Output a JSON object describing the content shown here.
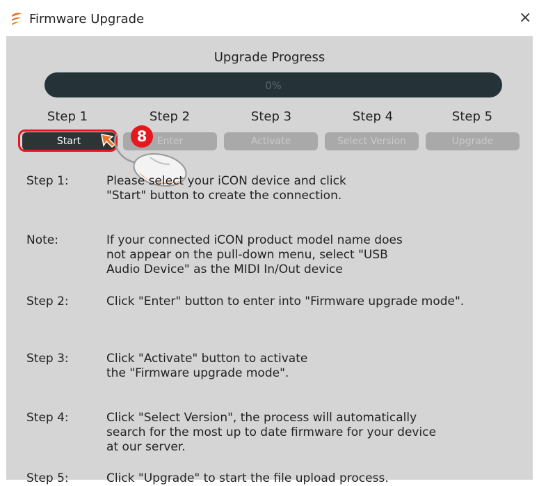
{
  "window": {
    "title": "Firmware Upgrade",
    "close_glyph": "×",
    "app_icon": "app-icon"
  },
  "progress": {
    "title": "Upgrade Progress",
    "value_text": "0%",
    "fraction": 0,
    "bar_color": "#253338"
  },
  "steps": [
    {
      "label": "Step 1",
      "button": "Start",
      "active": true
    },
    {
      "label": "Step 2",
      "button": "Enter",
      "active": false
    },
    {
      "label": "Step 3",
      "button": "Activate",
      "active": false
    },
    {
      "label": "Step 4",
      "button": "Select Version",
      "active": false
    },
    {
      "label": "Step 5",
      "button": "Upgrade",
      "active": false
    }
  ],
  "annotation": {
    "badge": "8",
    "highlight_color": "#e5171f"
  },
  "instructions": [
    {
      "label": "Step 1:",
      "text": "Please select your iCON device and click\n\"Start\" button to create the connection."
    },
    {
      "label": "Note:",
      "text": "If your connected iCON product model name does\nnot appear on the pull-down menu, select \"USB\nAudio Device\" as the MIDI In/Out device"
    },
    {
      "label": "Step 2:",
      "text": "Click \"Enter\" button to enter into \"Firmware upgrade mode\"."
    },
    {
      "label": "Step 3:",
      "text": "Click \"Activate\" button to activate\nthe \"Firmware upgrade mode\"."
    },
    {
      "label": "Step 4:",
      "text": "Click \"Select Version\", the process will automatically\nsearch for the most up to date firmware for your device\nat our server."
    },
    {
      "label": "Step 5:",
      "text": "Click \"Upgrade\" to start the file upload process."
    }
  ]
}
